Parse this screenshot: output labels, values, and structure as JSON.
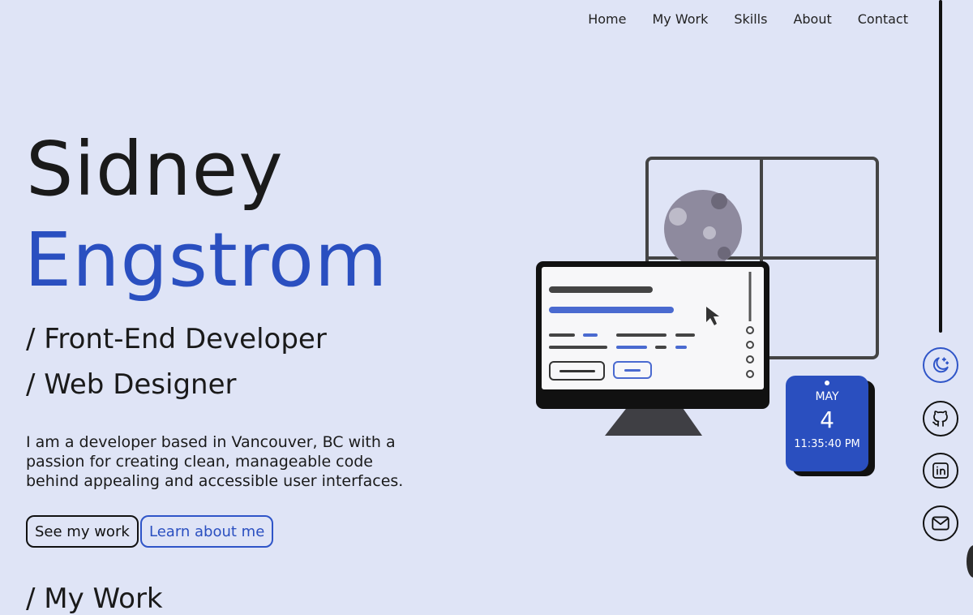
{
  "nav": {
    "items": [
      "Home",
      "My Work",
      "Skills",
      "About",
      "Contact"
    ]
  },
  "hero": {
    "first_name": "Sidney",
    "last_name": "Engstrom",
    "roles": [
      "/ Front-End Developer",
      "/ Web Designer"
    ],
    "intro": "I am a developer based in Vancouver, BC with a passion for creating clean, manageable code behind appealing and accessible user interfaces.",
    "primary_button": "See my work",
    "secondary_button": "Learn about me"
  },
  "calendar": {
    "month": "MAY",
    "day": "4",
    "time": "11:35:40 PM"
  },
  "next_section": "/ My Work",
  "social": {
    "icons": [
      "moon-stars-icon",
      "github-icon",
      "linkedin-icon",
      "mail-icon"
    ]
  },
  "colors": {
    "background": "#dfe4f6",
    "accent": "#2a4fc0",
    "text": "#1a1a1a"
  }
}
